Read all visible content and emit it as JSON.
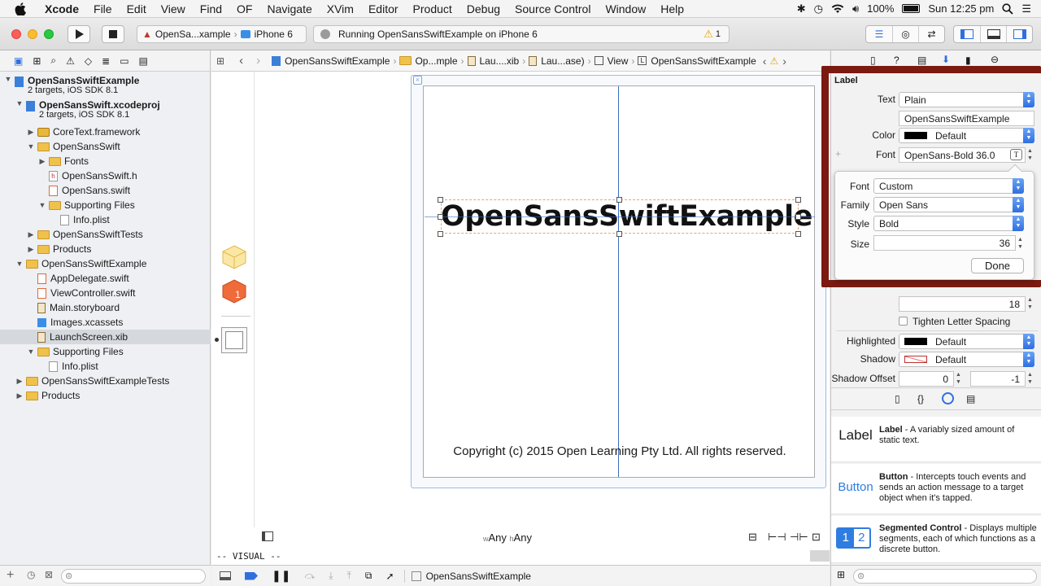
{
  "menubar": {
    "apple": "",
    "app_name": "Xcode",
    "items": [
      "File",
      "Edit",
      "View",
      "Find",
      "OF",
      "Navigate",
      "XVim",
      "Editor",
      "Product",
      "Debug",
      "Source Control",
      "Window",
      "Help"
    ],
    "battery": "100%",
    "clock": "Sun 12:25 pm"
  },
  "toolbar": {
    "scheme": "OpenSa...xample",
    "device": "iPhone 6",
    "activity_text": "Running OpenSansSwiftExample on iPhone 6",
    "warning_count": "1"
  },
  "navigator": {
    "rows": [
      {
        "label": "OpenSansSwiftExample",
        "sub": "2 targets, iOS SDK 8.1",
        "indent": 0,
        "disc": "▼",
        "type": "project",
        "bold": true
      },
      {
        "label": "OpenSansSwift.xcodeproj",
        "sub": "2 targets, iOS SDK 8.1",
        "indent": 1,
        "disc": "▼",
        "type": "project",
        "bold": true
      },
      {
        "label": "CoreText.framework",
        "indent": 2,
        "disc": "▶",
        "type": "framework"
      },
      {
        "label": "OpenSansSwift",
        "indent": 2,
        "disc": "▼",
        "type": "folder"
      },
      {
        "label": "Fonts",
        "indent": 3,
        "disc": "▶",
        "type": "folder"
      },
      {
        "label": "OpenSansSwift.h",
        "indent": 3,
        "disc": "",
        "type": "h"
      },
      {
        "label": "OpenSans.swift",
        "indent": 3,
        "disc": "",
        "type": "swift"
      },
      {
        "label": "Supporting Files",
        "indent": 3,
        "disc": "▼",
        "type": "folder"
      },
      {
        "label": "Info.plist",
        "indent": 4,
        "disc": "",
        "type": "plist"
      },
      {
        "label": "OpenSansSwiftTests",
        "indent": 2,
        "disc": "▶",
        "type": "folder"
      },
      {
        "label": "Products",
        "indent": 2,
        "disc": "▶",
        "type": "folder"
      },
      {
        "label": "OpenSansSwiftExample",
        "indent": 1,
        "disc": "▼",
        "type": "folder"
      },
      {
        "label": "AppDelegate.swift",
        "indent": 2,
        "disc": "",
        "type": "swift"
      },
      {
        "label": "ViewController.swift",
        "indent": 2,
        "disc": "",
        "type": "swift"
      },
      {
        "label": "Main.storyboard",
        "indent": 2,
        "disc": "",
        "type": "storyboard"
      },
      {
        "label": "Images.xcassets",
        "indent": 2,
        "disc": "",
        "type": "assets"
      },
      {
        "label": "LaunchScreen.xib",
        "indent": 2,
        "disc": "",
        "type": "xib",
        "selected": true
      },
      {
        "label": "Supporting Files",
        "indent": 2,
        "disc": "▼",
        "type": "folder"
      },
      {
        "label": "Info.plist",
        "indent": 3,
        "disc": "",
        "type": "plist"
      },
      {
        "label": "OpenSansSwiftExampleTests",
        "indent": 1,
        "disc": "▶",
        "type": "folder"
      },
      {
        "label": "Products",
        "indent": 1,
        "disc": "▶",
        "type": "folder"
      }
    ]
  },
  "jumpbar": {
    "crumbs": [
      "OpenSansSwiftExample",
      "Op...mple",
      "Lau....xib",
      "Lau...ase)",
      "View",
      "OpenSansSwiftExample"
    ]
  },
  "canvas": {
    "title_label": "OpenSansSwiftExample",
    "copyright": "Copyright (c) 2015 Open Learning Pty Ltd. All rights reserved.",
    "size_w_prefix": "w",
    "size_w": "Any",
    "size_h_prefix": "h",
    "size_h": "Any",
    "debug_text": "-- VISUAL --",
    "bottom_label": "OpenSansSwiftExample"
  },
  "inspector": {
    "section": "Label",
    "text_label": "Text",
    "text_value": "Plain",
    "text_content": "OpenSansSwiftExample",
    "color_label": "Color",
    "color_value": "Default",
    "font_label": "Font",
    "font_value": "OpenSans-Bold 36.0",
    "autoshrink_value": "18",
    "tighten": "Tighten Letter Spacing",
    "highlighted_label": "Highlighted",
    "highlighted_value": "Default",
    "shadow_label": "Shadow",
    "shadow_value": "Default",
    "shadow_offset_label": "Shadow Offset",
    "shadow_x": "0",
    "shadow_y": "-1",
    "font_popover": {
      "font_label": "Font",
      "font_value": "Custom",
      "family_label": "Family",
      "family_value": "Open Sans",
      "style_label": "Style",
      "style_value": "Bold",
      "size_label": "Size",
      "size_value": "36",
      "done": "Done"
    }
  },
  "library": {
    "items": [
      {
        "thumb": "Label",
        "name": "Label",
        "desc": " - A variably sized amount of static text."
      },
      {
        "thumb": "Button",
        "name": "Button",
        "desc": " - Intercepts touch events and sends an action message to a target object when it's tapped."
      },
      {
        "thumb": "12",
        "name": "Segmented Control",
        "desc": " - Displays multiple segments, each of which functions as a discrete button."
      }
    ]
  },
  "colors": {
    "accent": "#2f6fe0",
    "highlight_frame": "#7a1a10",
    "folder": "#f0c14b"
  }
}
